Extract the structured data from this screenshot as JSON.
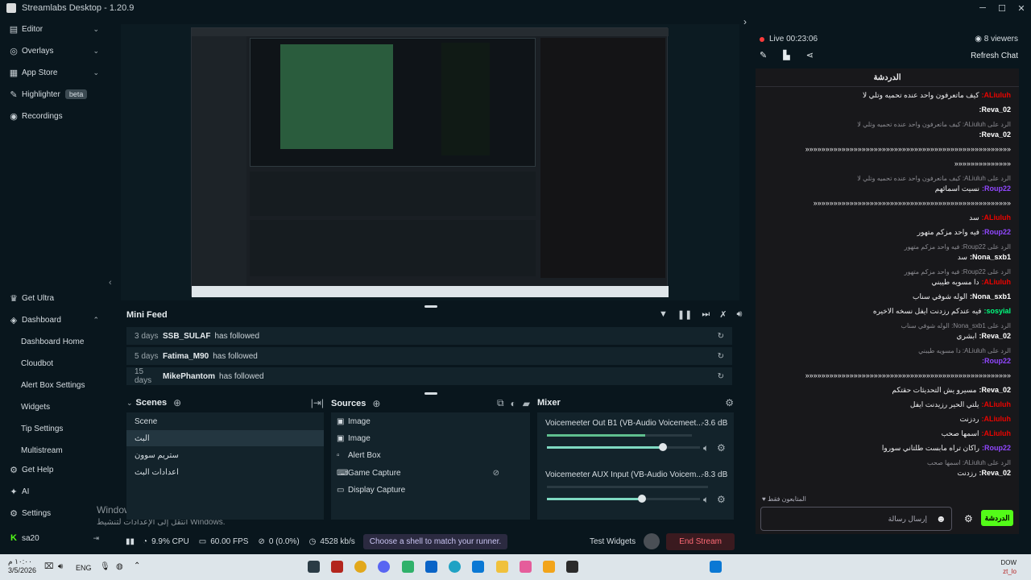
{
  "app": {
    "title": "Streamlabs Desktop - 1.20.9"
  },
  "sidebar": {
    "items": [
      {
        "label": "Editor",
        "icon": "editor-icon"
      },
      {
        "label": "Overlays",
        "icon": "overlays-icon"
      },
      {
        "label": "App Store",
        "icon": "appstore-icon"
      },
      {
        "label": "Highlighter",
        "icon": "highlighter-icon",
        "badge": "beta"
      },
      {
        "label": "Recordings",
        "icon": "recordings-icon"
      },
      {
        "label": "Get Ultra",
        "icon": "ultra-icon"
      },
      {
        "label": "Dashboard",
        "icon": "dashboard-icon"
      },
      {
        "label": "Dashboard Home"
      },
      {
        "label": "Cloudbot"
      },
      {
        "label": "Alert Box Settings"
      },
      {
        "label": "Widgets"
      },
      {
        "label": "Tip Settings"
      },
      {
        "label": "Multistream"
      },
      {
        "label": "Get Help",
        "icon": "help-icon"
      },
      {
        "label": "AI",
        "icon": "ai-icon"
      },
      {
        "label": "Settings",
        "icon": "settings-icon"
      },
      {
        "label": "sa20",
        "icon": "user-icon"
      }
    ]
  },
  "windows_watermark": {
    "line1": "Windows تنشيط",
    "line2": "انتقل إلى الإعدادات لتنشيط Windows."
  },
  "minifeed": {
    "title": "Mini Feed",
    "rows": [
      {
        "days": "3 days",
        "user": "SSB_SULAF",
        "action": "has followed"
      },
      {
        "days": "5 days",
        "user": "Fatima_M90",
        "action": "has followed"
      },
      {
        "days": "15 days",
        "user": "MikePhantom",
        "action": "has followed"
      }
    ]
  },
  "scenes": {
    "title": "Scenes",
    "items": [
      "Scene",
      "البث",
      "ستريم سوون",
      "اعدادات البث"
    ],
    "selected": 1
  },
  "sources": {
    "title": "Sources",
    "items": [
      "Image",
      "Image",
      "Alert Box",
      "Game Capture",
      "Display Capture"
    ]
  },
  "mixer": {
    "title": "Mixer",
    "channels": [
      {
        "name": "Voicemeeter Out B1 (VB-Audio Voicemeet...",
        "db": "-3.6 dB",
        "level": 0.76
      },
      {
        "name": "Voicemeeter AUX Input (VB-Audio Voicem...",
        "db": "-8.3 dB",
        "level": 0.62
      }
    ]
  },
  "status": {
    "cpu": "9.9% CPU",
    "fps": "60.00 FPS",
    "dropped": "0 (0.0%)",
    "bitrate": "4528 kb/s",
    "tip": "Choose a shell to match your runner.",
    "test_widgets": "Test Widgets",
    "end_stream": "End Stream"
  },
  "stream": {
    "live": "Live 00:23:06",
    "viewers": "8 viewers",
    "refresh": "Refresh Chat"
  },
  "chat": {
    "title": "الدردشة",
    "input_placeholder": "إرسال رسالة",
    "send": "الدردشة",
    "footer": "المتابعون فقط",
    "messages": [
      {
        "user": "ALiuluh",
        "text": "كيف ماتعرفون واحد عنده تحميه وتلي لا",
        "color": "#eb0400"
      },
      {
        "user": "Reva_02",
        "text": "",
        "color": "#ffffff"
      },
      {
        "reply": "الرد على ALiuluh: كيف ماتعرفون واحد عنده تحميه وتلي لا"
      },
      {
        "user": "Reva_02",
        "text": "",
        "color": "#ffffff"
      },
      {
        "text": "«««««««««««««««««««««««««««««««««««««««««««««««««««"
      },
      {
        "text": "««««««««««««««"
      },
      {
        "reply": "الرد على ALiuluh: كيف ماتعرفون واحد عنده تحميه وتلي لا"
      },
      {
        "user": "Roup22",
        "text": "نسيت اسمائهم",
        "color": "#9147ff"
      },
      {
        "text": "«««««««««««««««««««««««««««««««««««««««««««««««««"
      },
      {
        "user": "ALiuluh",
        "text": "سد",
        "color": "#eb0400"
      },
      {
        "user": "Roup22",
        "text": "فيه واحد مزكم متهور",
        "color": "#9147ff"
      },
      {
        "reply": "الرد على Roup22: فيه واحد مزكم متهور"
      },
      {
        "user": "Nona_sxb1",
        "text": "سد",
        "color": "#ffffff"
      },
      {
        "reply": "الرد على Roup22: فيه واحد مزكم متهور"
      },
      {
        "user": "ALiuluh",
        "text": "دا مسويه طيبني",
        "color": "#eb0400"
      },
      {
        "user": "Nona_sxb1",
        "text": "الوله شوفي سناب",
        "color": "#ffffff"
      },
      {
        "user": "sosyial",
        "text": "فيه عندكم رزدنت ايفل نسخه الاخيره",
        "color": "#00ff7f"
      },
      {
        "reply": "الرد على Nona_sxb1: الوله شوفي سناب"
      },
      {
        "user": "Reva_02",
        "text": "ابشري",
        "color": "#ffffff"
      },
      {
        "reply": "الرد على ALiuluh: دا مسويه طيبني"
      },
      {
        "user": "Roup22",
        "text": "",
        "color": "#9147ff"
      },
      {
        "text": "«««««««««««««««««««««««««««««««««««««««««««««««««««"
      },
      {
        "user": "Reva_02",
        "text": "مسيرو يش التحديثات حقتكم",
        "color": "#ffffff"
      },
      {
        "user": "ALiuluh",
        "text": "يلتي الحير رزيدنت ايفل",
        "color": "#eb0400"
      },
      {
        "user": "ALiuluh",
        "text": "ردزنت",
        "color": "#eb0400"
      },
      {
        "user": "ALiuluh",
        "text": "اسمها صحب",
        "color": "#eb0400"
      },
      {
        "user": "Roup22",
        "text": "راكان تراه مابست طلتاني سوروا",
        "color": "#9147ff"
      },
      {
        "reply": "الرد على ALiuluh: اسمها صحب"
      },
      {
        "user": "Reva_02",
        "text": "رزدنت",
        "color": "#ffffff"
      }
    ]
  },
  "taskbar": {
    "time": "١٠:٠٠ م",
    "date": "3/5/2026",
    "lang": "ENG",
    "weather": "DOW",
    "weather2": "zt_lo"
  }
}
